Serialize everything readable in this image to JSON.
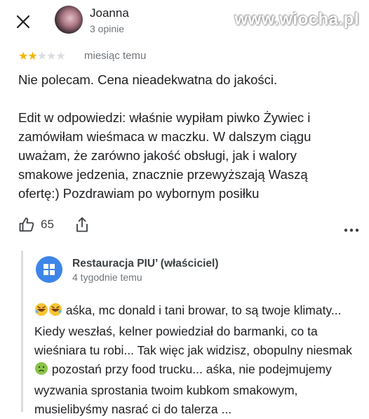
{
  "header": {
    "reviewer_name": "Joanna",
    "reviewer_reviews": "3 opinie",
    "watermark": "www.wiocha.pl"
  },
  "review": {
    "rating": 2,
    "rating_max": 5,
    "date": "miesiąc temu",
    "paragraph1": "Nie polecam. Cena nieadekwatna do jakości.",
    "paragraph2": "Edit w odpowiedzi: właśnie wypiłam piwko Żywiec i zamówiłam wieśmaca w maczku. W dalszym ciągu uważam, że zarówno jakość obsługi, jak i walory smakowe jedzenia, znacznie przewyższają Waszą ofertę:) Pozdrawiam po wybornym posiłku",
    "likes": "65"
  },
  "icons": {
    "close": "close-icon",
    "like": "thumbs-up-icon",
    "share": "share-icon",
    "more": "more-horizontal-icon",
    "owner_logo": "restaurant-logo-icon"
  },
  "reply": {
    "owner_name": "Restauracja PIU’ (właściciel)",
    "date": "4 tygodnie temu",
    "text_part1": "aśka, mc donald i tani browar, to są twoje klimaty...  Kiedy weszłaś, kelner powiedział do barmanki, co ta wieśniara tu robi... Tak więc jak widzisz, obopulny niesmak",
    "text_part2": "pozostań przy food trucku... aśka, nie podejmujemy wyzwania sprostania twoim kubkom smakowym, musielibyśmy nasrać ci do talerza ..."
  },
  "colors": {
    "star_active": "#f4b400",
    "star_inactive": "#dadce0",
    "owner_logo_bg": "#3d85e8"
  }
}
